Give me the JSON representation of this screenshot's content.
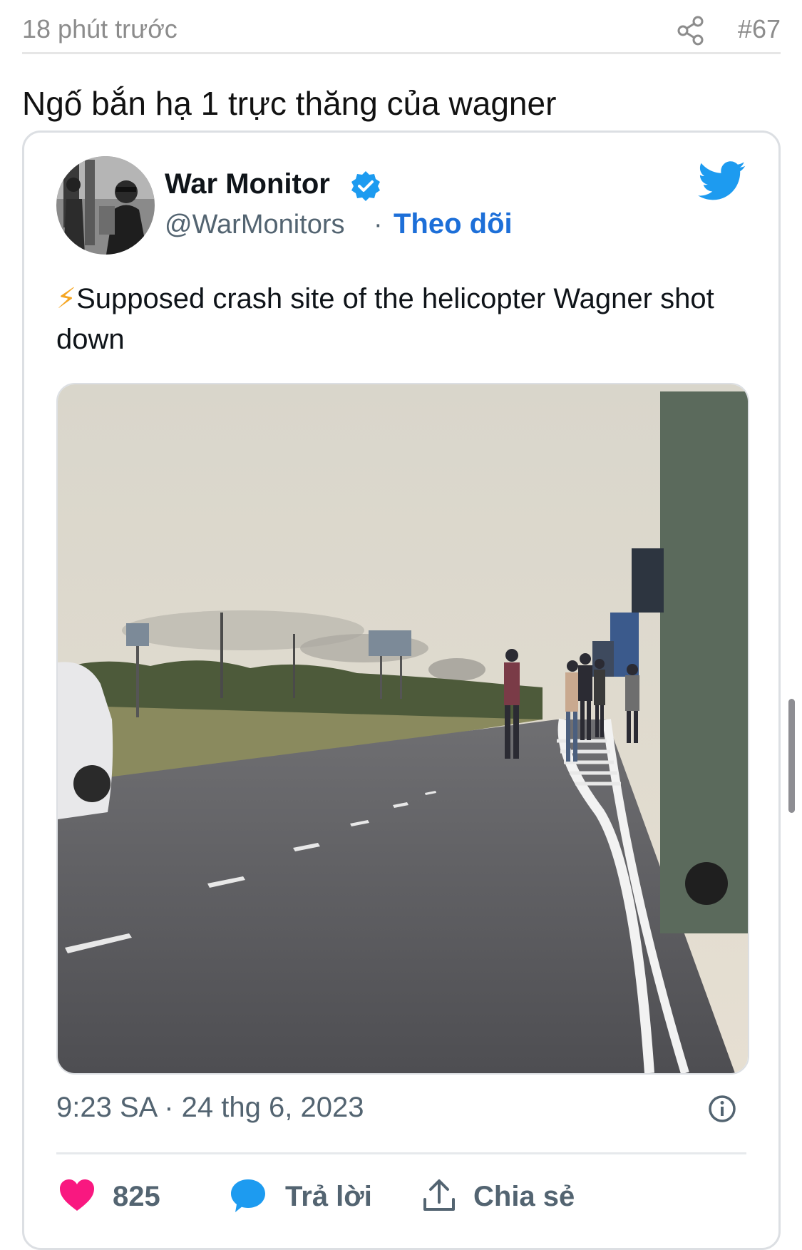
{
  "post": {
    "time": "18 phút trước",
    "number": "#67",
    "text": "Ngố bắn hạ 1 trực thăng của wagner"
  },
  "tweet": {
    "author_name": "War Monitor",
    "handle": "@WarMonitors",
    "separator": "·",
    "follow_label": "Theo dõi",
    "text_emoji": "⚡",
    "text": "Supposed crash site of the helicopter Wagner shot down",
    "timestamp": "9:23 SA · 24 thg 6, 2023",
    "likes": "825",
    "reply_label": "Trả lời",
    "share_label": "Chia sẻ"
  },
  "icons": {
    "share": "share-icon",
    "verified": "verified-badge-icon",
    "twitter": "twitter-bird-icon",
    "info": "info-icon",
    "like": "heart-icon",
    "reply": "speech-bubble-icon",
    "share_tweet": "upload-icon"
  },
  "colors": {
    "accent": "#1d6fd8",
    "twitter_blue": "#1d9bf0",
    "heart": "#f91880",
    "muted": "#536471"
  }
}
